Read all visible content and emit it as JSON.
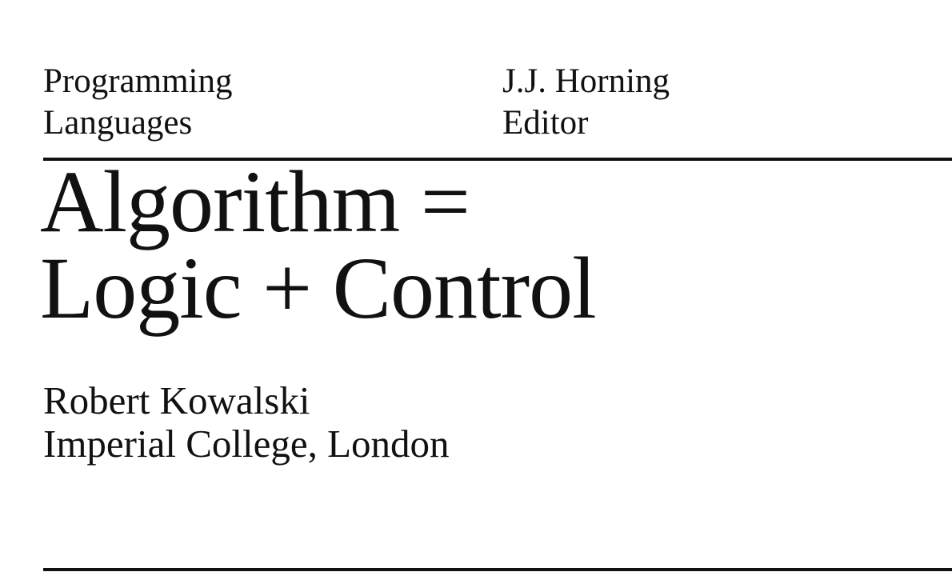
{
  "header": {
    "section_label": [
      "Programming",
      "Languages"
    ],
    "editor": [
      "J.J. Horning",
      "Editor"
    ]
  },
  "title": [
    "Algorithm =",
    "Logic + Control"
  ],
  "author": {
    "name": "Robert Kowalski",
    "affiliation": "Imperial College, London"
  }
}
